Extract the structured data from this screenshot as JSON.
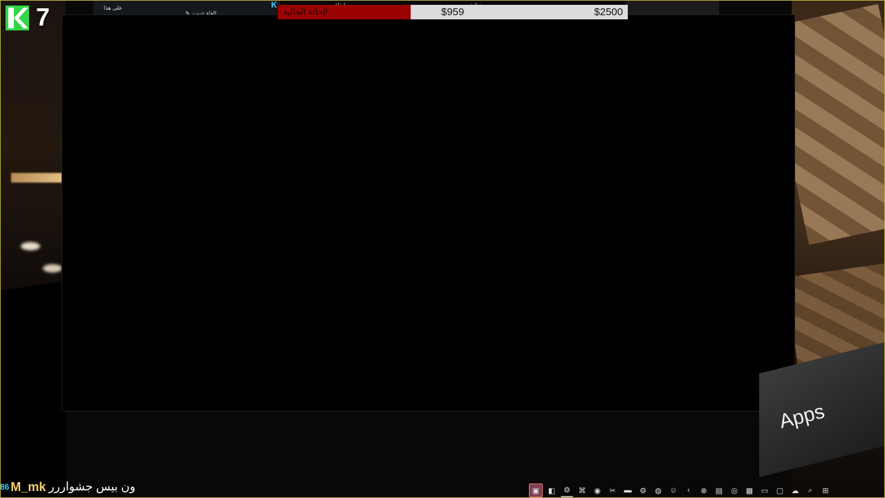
{
  "hud": {
    "kill_count": "7",
    "logo_letter": "K"
  },
  "money": {
    "label": "الحالة الحالية",
    "cash": "$959",
    "bank": "$2500",
    "fill_fraction": 0.38,
    "fill_color": "#9b0303"
  },
  "menu_fragments": [
    {
      "text": "على هذا"
    },
    {
      "text": "إلغاء تثبيت"
    },
    {
      "text": "وإيقاف"
    },
    {
      "text": "زيادة"
    },
    {
      "text": ""
    }
  ],
  "apps_tile": {
    "label": "Apps"
  },
  "chat": {
    "tag": "86",
    "user": "M_mk",
    "message": "ون بيس جشواررر"
  },
  "taskbar": {
    "icons": [
      {
        "name": "stream-icon",
        "glyph": "▣"
      },
      {
        "name": "window-icon",
        "glyph": "◧"
      },
      {
        "name": "steam-icon",
        "glyph": "⚙"
      },
      {
        "name": "gamepad-icon",
        "glyph": "⌘"
      },
      {
        "name": "record-icon",
        "glyph": "◉"
      },
      {
        "name": "tool-icon",
        "glyph": "✂"
      },
      {
        "name": "flag-icon",
        "glyph": "▬"
      },
      {
        "name": "steam2-icon",
        "glyph": "⚙"
      },
      {
        "name": "browser-icon",
        "glyph": "◍"
      },
      {
        "name": "discord-icon",
        "glyph": "☺"
      },
      {
        "name": "arrow-icon",
        "glyph": "‹"
      },
      {
        "name": "xbox-icon",
        "glyph": "⊗"
      },
      {
        "name": "terminal-icon",
        "glyph": "▤"
      },
      {
        "name": "chrome-icon",
        "glyph": "◎"
      },
      {
        "name": "notes-icon",
        "glyph": "▦"
      },
      {
        "name": "folder-icon",
        "glyph": "▭"
      },
      {
        "name": "app-icon",
        "glyph": "▢"
      },
      {
        "name": "cloud-icon",
        "glyph": "☁"
      },
      {
        "name": "search-icon",
        "glyph": "⌕"
      },
      {
        "name": "windows-icon",
        "glyph": "⊞"
      }
    ]
  }
}
